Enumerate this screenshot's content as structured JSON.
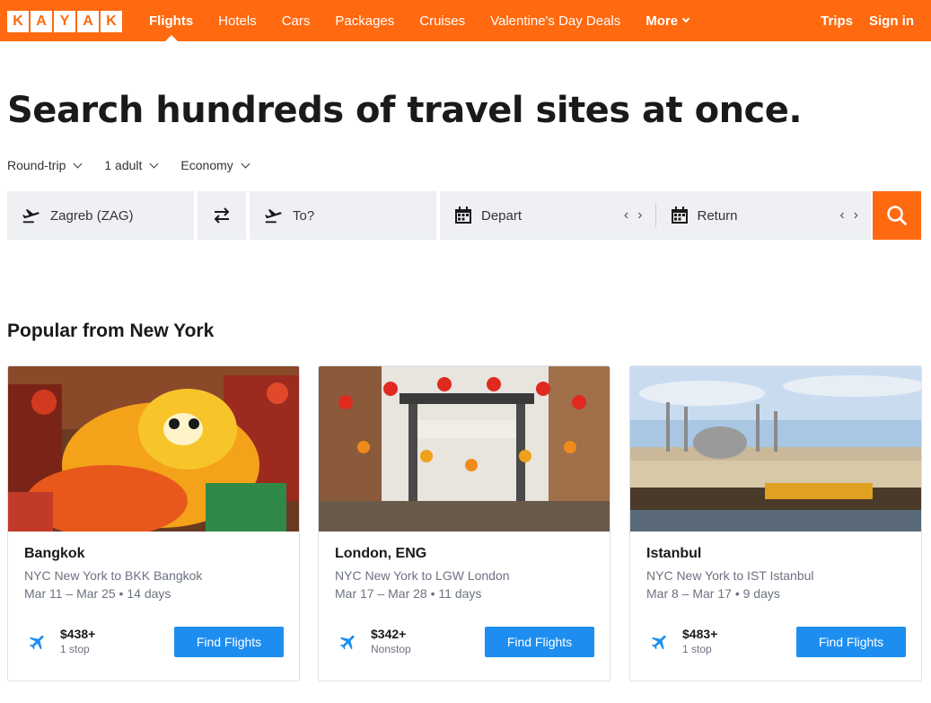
{
  "logo_letters": [
    "K",
    "A",
    "Y",
    "A",
    "K"
  ],
  "nav": {
    "items": [
      {
        "label": "Flights",
        "active": true
      },
      {
        "label": "Hotels"
      },
      {
        "label": "Cars"
      },
      {
        "label": "Packages"
      },
      {
        "label": "Cruises"
      },
      {
        "label": "Valentine's Day Deals"
      }
    ],
    "more_label": "More",
    "trips_label": "Trips",
    "signin_label": "Sign in"
  },
  "headline": "Search hundreds of travel sites at once.",
  "options": {
    "trip_type": "Round-trip",
    "travelers": "1 adult",
    "cabin": "Economy"
  },
  "search": {
    "from_value": "Zagreb (ZAG)",
    "to_placeholder": "To?",
    "depart_label": "Depart",
    "return_label": "Return"
  },
  "popular": {
    "title": "Popular from New York",
    "find_label": "Find Flights",
    "cards": [
      {
        "city": "Bangkok",
        "route": "NYC New York to BKK Bangkok",
        "dates": "Mar 11 – Mar 25 • 14 days",
        "price": "$438+",
        "stops": "1 stop"
      },
      {
        "city": "London, ENG",
        "route": "NYC New York to LGW London",
        "dates": "Mar 17 – Mar 28 • 11 days",
        "price": "$342+",
        "stops": "Nonstop"
      },
      {
        "city": "Istanbul",
        "route": "NYC New York to IST Istanbul",
        "dates": "Mar 8 – Mar 17 • 9 days",
        "price": "$483+",
        "stops": "1 stop"
      }
    ]
  },
  "colors": {
    "brand": "#ff690f",
    "button_blue": "#1d8ef0",
    "field_bg": "#eef0f3"
  }
}
